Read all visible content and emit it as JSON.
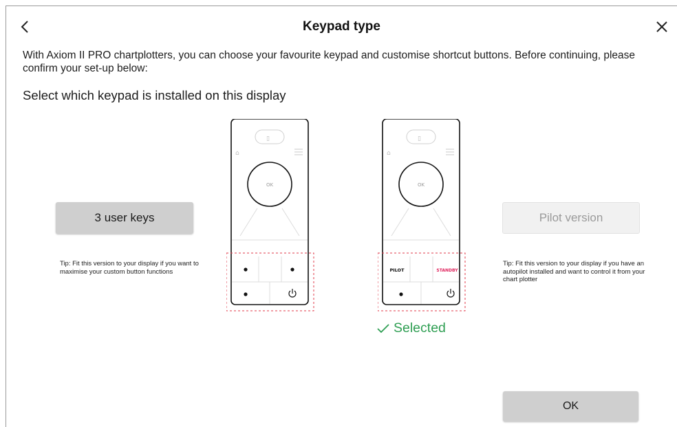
{
  "header": {
    "title": "Keypad type",
    "back_icon": "chevron-left-icon",
    "close_icon": "close-icon"
  },
  "intro": {
    "text": "With Axiom II PRO chartplotters, you can choose your favourite keypad and customise shortcut buttons. Before continuing, please confirm your set-up below:"
  },
  "subheading": "Select which keypad is installed on this display",
  "options": {
    "user_keys": {
      "label": "3 user keys",
      "tip": "Tip: Fit this version to your display if you want to maximise your custom button functions"
    },
    "pilot": {
      "label": "Pilot version",
      "tip": "Tip: Fit this version to your display if you have an autopilot installed and want to control it from your chart plotter"
    }
  },
  "keypad_images": {
    "ok_label": "OK",
    "pilot_key": "PILOT",
    "standby_key": "STANDBY"
  },
  "selection": {
    "status": "Selected",
    "selected_option": "pilot"
  },
  "footer": {
    "ok_label": "OK"
  },
  "colors": {
    "selected_green": "#2e9e52",
    "highlight_red": "#e03a4a",
    "standby_pink": "#e0245e"
  }
}
